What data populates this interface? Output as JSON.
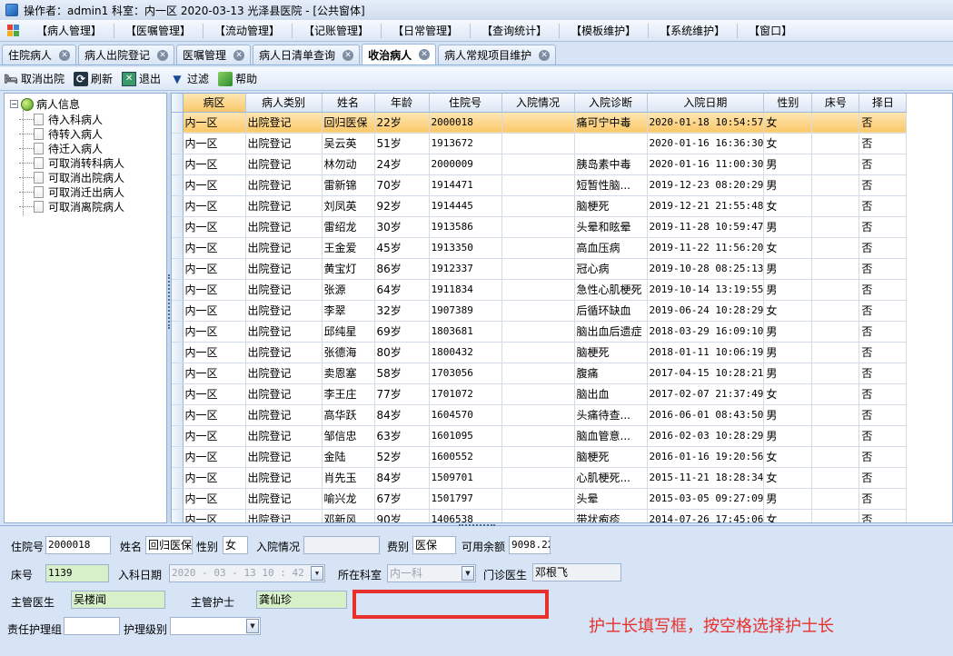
{
  "title": "操作者：admin1  科室：内一区  2020-03-13  光泽县医院 - [公共窗体]",
  "menu": [
    "【病人管理】",
    "【医嘱管理】",
    "【流动管理】",
    "【记账管理】",
    "【日常管理】",
    "【查询统计】",
    "【模板维护】",
    "【系统维护】",
    "【窗口】"
  ],
  "tabs": [
    {
      "label": "住院病人",
      "active": false
    },
    {
      "label": "病人出院登记",
      "active": false
    },
    {
      "label": "医嘱管理",
      "active": false
    },
    {
      "label": "病人日清单查询",
      "active": false
    },
    {
      "label": "收治病人",
      "active": true
    },
    {
      "label": "病人常规项目维护",
      "active": false
    }
  ],
  "toolbar": {
    "cancel_discharge": "取消出院",
    "refresh": "刷新",
    "exit": "退出",
    "filter": "过滤",
    "help": "帮助"
  },
  "tree": {
    "root": "病人信息",
    "children": [
      "待入科病人",
      "待转入病人",
      "待迁入病人",
      "可取消转科病人",
      "可取消出院病人",
      "可取消迁出病人",
      "可取消离院病人"
    ]
  },
  "grid": {
    "columns": [
      "病区",
      "病人类别",
      "姓名",
      "年龄",
      "住院号",
      "入院情况",
      "入院诊断",
      "入院日期",
      "性别",
      "床号",
      "择日"
    ],
    "rows": [
      [
        "内一区",
        "出院登记",
        "回归医保",
        "22岁",
        "2000018",
        "",
        "痛可宁中毒",
        "2020-01-18 10:54:57",
        "女",
        "",
        "否"
      ],
      [
        "内一区",
        "出院登记",
        "吴云英",
        "51岁",
        "1913672",
        "",
        "",
        "2020-01-16 16:36:30",
        "女",
        "",
        "否"
      ],
      [
        "内一区",
        "出院登记",
        "林勿动",
        "24岁",
        "2000009",
        "",
        "胰岛素中毒",
        "2020-01-16 11:00:30",
        "男",
        "",
        "否"
      ],
      [
        "内一区",
        "出院登记",
        "雷新锦",
        "70岁",
        "1914471",
        "",
        "短暂性脑...",
        "2019-12-23 08:20:29",
        "男",
        "",
        "否"
      ],
      [
        "内一区",
        "出院登记",
        "刘凤英",
        "92岁",
        "1914445",
        "",
        "脑梗死",
        "2019-12-21 21:55:48",
        "女",
        "",
        "否"
      ],
      [
        "内一区",
        "出院登记",
        "雷绍龙",
        "30岁",
        "1913586",
        "",
        "头晕和眩晕",
        "2019-11-28 10:59:47",
        "男",
        "",
        "否"
      ],
      [
        "内一区",
        "出院登记",
        "王金爱",
        "45岁",
        "1913350",
        "",
        "高血压病",
        "2019-11-22 11:56:20",
        "女",
        "",
        "否"
      ],
      [
        "内一区",
        "出院登记",
        "黄宝灯",
        "86岁",
        "1912337",
        "",
        "冠心病",
        "2019-10-28 08:25:13",
        "男",
        "",
        "否"
      ],
      [
        "内一区",
        "出院登记",
        "张源",
        "64岁",
        "1911834",
        "",
        "急性心肌梗死",
        "2019-10-14 13:19:55",
        "男",
        "",
        "否"
      ],
      [
        "内一区",
        "出院登记",
        "李翠",
        "32岁",
        "1907389",
        "",
        "后循环缺血",
        "2019-06-24 10:28:29",
        "女",
        "",
        "否"
      ],
      [
        "内一区",
        "出院登记",
        "邱纯星",
        "69岁",
        "1803681",
        "",
        "脑出血后遗症",
        "2018-03-29 16:09:10",
        "男",
        "",
        "否"
      ],
      [
        "内一区",
        "出院登记",
        "张德海",
        "80岁",
        "1800432",
        "",
        "脑梗死",
        "2018-01-11 10:06:19",
        "男",
        "",
        "否"
      ],
      [
        "内一区",
        "出院登记",
        "卖恩塞",
        "58岁",
        "1703056",
        "",
        "腹痛",
        "2017-04-15 10:28:21",
        "男",
        "",
        "否"
      ],
      [
        "内一区",
        "出院登记",
        "李王庄",
        "77岁",
        "1701072",
        "",
        "脑出血",
        "2017-02-07 21:37:49",
        "女",
        "",
        "否"
      ],
      [
        "内一区",
        "出院登记",
        "高华跃",
        "84岁",
        "1604570",
        "",
        "头痛待查...",
        "2016-06-01 08:43:50",
        "男",
        "",
        "否"
      ],
      [
        "内一区",
        "出院登记",
        "邹信忠",
        "63岁",
        "1601095",
        "",
        "脑血管意...",
        "2016-02-03 10:28:29",
        "男",
        "",
        "否"
      ],
      [
        "内一区",
        "出院登记",
        "金陆",
        "52岁",
        "1600552",
        "",
        "脑梗死",
        "2016-01-16 19:20:56",
        "女",
        "",
        "否"
      ],
      [
        "内一区",
        "出院登记",
        "肖先玉",
        "84岁",
        "1509701",
        "",
        "心肌梗死...",
        "2015-11-21 18:28:34",
        "女",
        "",
        "否"
      ],
      [
        "内一区",
        "出院登记",
        "喻兴龙",
        "67岁",
        "1501797",
        "",
        "头晕",
        "2015-03-05 09:27:09",
        "男",
        "",
        "否"
      ],
      [
        "内一区",
        "出院登记",
        "邓新风",
        "90岁",
        "1406538",
        "",
        "带状疱疹",
        "2014-07-26 17:45:06",
        "女",
        "",
        "否"
      ]
    ]
  },
  "form": {
    "inpatient_no_label": "住院号",
    "inpatient_no": "2000018",
    "name_label": "姓名",
    "name": "回归医保",
    "gender_label": "性别",
    "gender": "女",
    "admit_status_label": "入院情况",
    "admit_status": "",
    "fee_type_label": "费别",
    "fee_type": "医保",
    "balance_label": "可用余额",
    "balance": "9098.22",
    "bed_label": "床号",
    "bed": "1139",
    "admit_date_label": "入科日期",
    "admit_date": "2020 - 03 - 13    10 : 42",
    "dept_label": "所在科室",
    "dept": "内一科",
    "clinic_doctor_label": "门诊医生",
    "clinic_doctor": "邓根飞",
    "attending_label": "主管医生",
    "attending": "吴楼闻",
    "nurse_label": "主管护士",
    "nurse": "龚仙珍",
    "head_nurse": "",
    "nurse_group_label": "责任护理组",
    "nurse_group": "",
    "nurse_level_label": "护理级别",
    "nurse_level": ""
  },
  "annotation": "护士长填写框，按空格选择护士长",
  "colors": {
    "highlight": "#e8302c",
    "selected_row": "#fbc86a",
    "frame": "#d6e4f5"
  }
}
